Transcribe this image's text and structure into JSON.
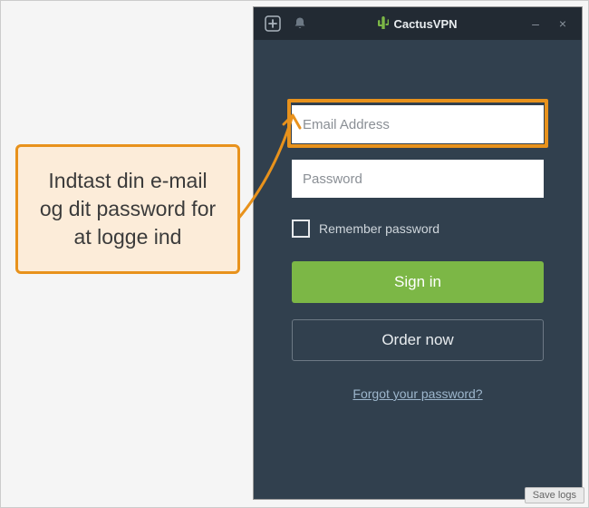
{
  "app": {
    "brand": "CactusVPN",
    "titlebar": {
      "add_icon": "add",
      "bell_icon": "notifications",
      "minimize": "–",
      "close": "×"
    }
  },
  "login": {
    "email_placeholder": "Email Address",
    "email_value": "",
    "password_placeholder": "Password",
    "password_value": "",
    "remember_label": "Remember password",
    "signin_label": "Sign in",
    "order_label": "Order now",
    "forgot_label": "Forgot your password?"
  },
  "footer": {
    "savelogs_label": "Save logs"
  },
  "annotation": {
    "callout_text": "Indtast din e-mail og dit password for at logge ind"
  }
}
